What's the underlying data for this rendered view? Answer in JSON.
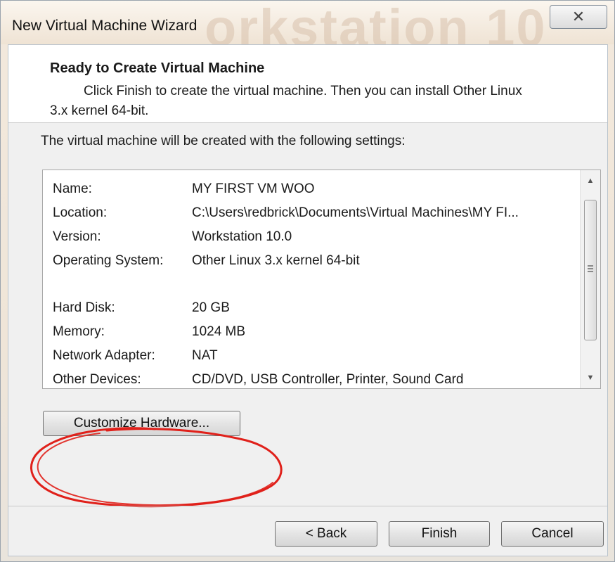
{
  "window": {
    "title": "New Virtual Machine Wizard",
    "watermark": "orkstation 10",
    "close_glyph": "✕"
  },
  "header": {
    "title": "Ready to Create Virtual Machine",
    "description_line1": "Click Finish to create the virtual machine. Then you can install Other Linux",
    "description_line2": "3.x kernel 64-bit."
  },
  "intro": "The virtual machine will be created with the following settings:",
  "settings": {
    "group1": [
      {
        "key": "Name:",
        "value": "MY FIRST VM WOO"
      },
      {
        "key": "Location:",
        "value": "C:\\Users\\redbrick\\Documents\\Virtual Machines\\MY FI..."
      },
      {
        "key": "Version:",
        "value": "Workstation 10.0"
      },
      {
        "key": "Operating System:",
        "value": "Other Linux 3.x kernel 64-bit"
      }
    ],
    "group2": [
      {
        "key": "Hard Disk:",
        "value": "20 GB"
      },
      {
        "key": "Memory:",
        "value": "1024 MB"
      },
      {
        "key": "Network Adapter:",
        "value": "NAT"
      },
      {
        "key": "Other Devices:",
        "value": "CD/DVD, USB Controller, Printer, Sound Card"
      }
    ]
  },
  "buttons": {
    "customize": "Customize Hardware...",
    "back": "< Back",
    "finish": "Finish",
    "cancel": "Cancel"
  },
  "annotation_color": "#e0201a"
}
